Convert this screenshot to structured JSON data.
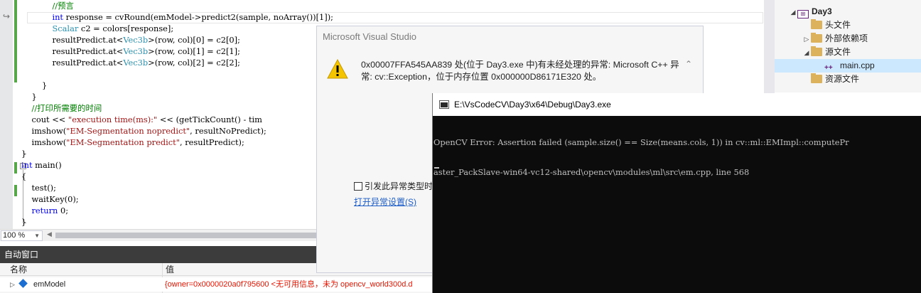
{
  "editor": {
    "lines": [
      [
        {
          "c": "cm",
          "t": "            //预言"
        }
      ],
      [
        {
          "c": "kw",
          "t": "            int"
        },
        {
          "c": "",
          "t": " response = cvRound(emModel->predict2(sample, noArray())[1]);"
        }
      ],
      [
        {
          "c": "ty",
          "t": "            Scalar"
        },
        {
          "c": "",
          "t": " c2 = colors[response];"
        }
      ],
      [
        {
          "c": "",
          "t": "            resultPredict.at<"
        },
        {
          "c": "ty",
          "t": "Vec3b"
        },
        {
          "c": "",
          "t": ">(row, col)[0] = c2[0];"
        }
      ],
      [
        {
          "c": "",
          "t": "            resultPredict.at<"
        },
        {
          "c": "ty",
          "t": "Vec3b"
        },
        {
          "c": "",
          "t": ">(row, col)[1] = c2[1];"
        }
      ],
      [
        {
          "c": "",
          "t": "            resultPredict.at<"
        },
        {
          "c": "ty",
          "t": "Vec3b"
        },
        {
          "c": "",
          "t": ">(row, col)[2] = c2[2];"
        }
      ],
      [
        {
          "c": "",
          "t": ""
        }
      ],
      [
        {
          "c": "",
          "t": "        }"
        }
      ],
      [
        {
          "c": "",
          "t": "    }"
        }
      ],
      [
        {
          "c": "cm",
          "t": "    //打印所需要的时间"
        }
      ],
      [
        {
          "c": "",
          "t": "    cout << "
        },
        {
          "c": "st",
          "t": "\"execution time(ms):\""
        },
        {
          "c": "",
          "t": " << (getTickCount() - tim"
        }
      ],
      [
        {
          "c": "",
          "t": "    imshow("
        },
        {
          "c": "st",
          "t": "\"EM-Segmentation nopredict\""
        },
        {
          "c": "",
          "t": ", resultNoPredict);"
        }
      ],
      [
        {
          "c": "",
          "t": "    imshow("
        },
        {
          "c": "st",
          "t": "\"EM-Segmentation predict\""
        },
        {
          "c": "",
          "t": ", resultPredict);"
        }
      ],
      [
        {
          "c": "",
          "t": "}"
        }
      ],
      [
        {
          "c": "kw",
          "t": "int"
        },
        {
          "c": "",
          "t": " main()"
        }
      ],
      [
        {
          "c": "",
          "t": "{"
        }
      ],
      [
        {
          "c": "",
          "t": "    test();"
        }
      ],
      [
        {
          "c": "",
          "t": "    waitKey(0);"
        }
      ],
      [
        {
          "c": "kw",
          "t": "    return"
        },
        {
          "c": "",
          "t": " 0;"
        }
      ],
      [
        {
          "c": "",
          "t": "}"
        }
      ]
    ],
    "zoom": "100 %"
  },
  "solution_explorer": {
    "items": [
      {
        "label": "Day3",
        "caret": "◢",
        "icon": "project-icon",
        "indent": 0,
        "bold": true
      },
      {
        "label": "头文件",
        "caret": "",
        "icon": "folder-icon",
        "indent": 1
      },
      {
        "label": "外部依赖项",
        "caret": "▷",
        "icon": "folder-icon",
        "indent": 1
      },
      {
        "label": "源文件",
        "caret": "◢",
        "icon": "folder-icon",
        "indent": 1
      },
      {
        "label": "main.cpp",
        "caret": "",
        "icon": "cpp-file-icon",
        "indent": 2,
        "selected": true
      },
      {
        "label": "资源文件",
        "caret": "",
        "icon": "folder-icon",
        "indent": 1
      }
    ]
  },
  "exception_dialog": {
    "title": "Microsoft Visual Studio",
    "message": "0x00007FFA545AA839 处(位于 Day3.exe 中)有未经处理的异常: Microsoft C++ 异常: cv::Exception，位于内存位置 0x000000D86171E320 处。",
    "checkbox_label": "引发此异常类型时",
    "link": "打开异常设置(S)"
  },
  "console": {
    "title": "E:\\VsCodeCV\\Day3\\x64\\Debug\\Day3.exe",
    "lines": [
      "OpenCV Error: Assertion failed (sample.size() == Size(means.cols, 1)) in cv::ml::EMImpl::computePr",
      "aster_PackSlave-win64-vc12-shared\\opencv\\modules\\ml\\src\\em.cpp, line 568"
    ]
  },
  "auto_window": {
    "title": "自动窗口",
    "columns": [
      "名称",
      "值"
    ],
    "rows": [
      {
        "name": "emModel",
        "value": "{owner=0x0000020a0f795600 <无可用信息，未为 opencv_world300d.d"
      }
    ]
  },
  "colors": {
    "auto_title_bg": "#3c3c3c",
    "console_bg": "#0c0c0c",
    "error_value": "#e51400",
    "change_bar": "#57a64a",
    "selection": "#cce8ff"
  }
}
